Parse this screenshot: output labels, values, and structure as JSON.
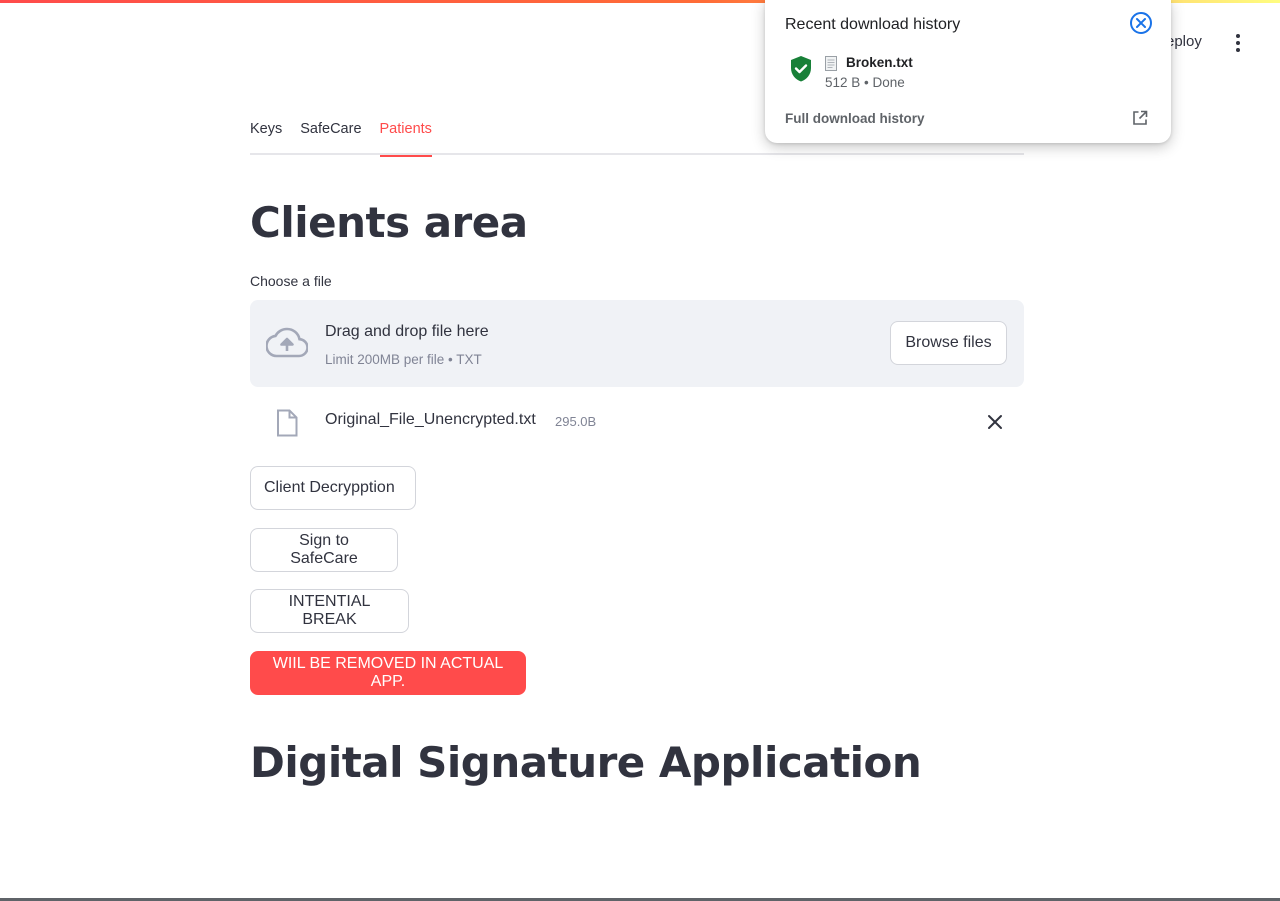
{
  "header": {
    "deploy_label": "eploy",
    "menu_icon": "kebab-menu-icon"
  },
  "tabs": [
    {
      "label": "Keys",
      "active": false
    },
    {
      "label": "SafeCare",
      "active": false
    },
    {
      "label": "Patients",
      "active": true
    }
  ],
  "main": {
    "title": "Clients area",
    "file_uploader": {
      "label": "Choose a file",
      "drop_title": "Drag and drop file here",
      "drop_subtitle": "Limit 200MB per file • TXT",
      "browse_label": "Browse files",
      "icon": "cloud-upload-icon"
    },
    "uploaded_file": {
      "name": "Original_File_Unencrypted.txt",
      "size": "295.0B",
      "icon": "file-icon",
      "remove_icon": "close-icon"
    },
    "buttons": {
      "decrypt": "Client Decrypption",
      "sign": "Sign to SafeCare",
      "break": "INTENTIAL BREAK",
      "remove_notice": "WIIL BE REMOVED IN ACTUAL APP."
    },
    "section_title": "Digital Signature Application"
  },
  "download_popup": {
    "title": "Recent download history",
    "item": {
      "name": "Broken.txt",
      "status": "512 B • Done",
      "icon": "shield-check-icon"
    },
    "full_history_label": "Full download history",
    "open_icon": "open-in-new-icon"
  },
  "colors": {
    "accent": "#ff4b4b",
    "text": "#31333f",
    "muted": "#808495",
    "dropzone_bg": "#f0f2f6",
    "shield_green": "#188038",
    "popup_close_blue": "#1a73e8"
  }
}
